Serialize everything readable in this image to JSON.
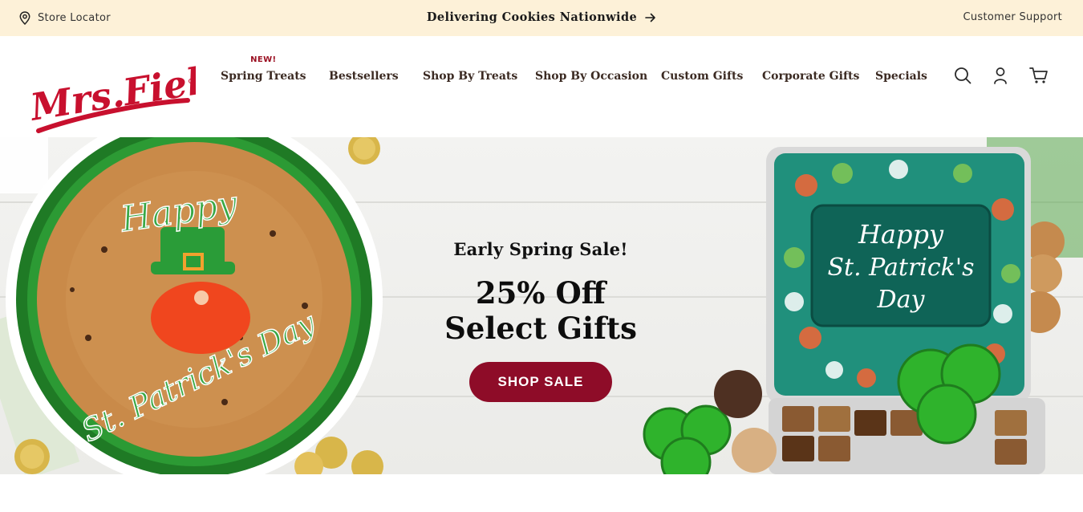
{
  "topbar": {
    "store_locator": "Store Locator",
    "promo": "Delivering Cookies Nationwide",
    "support": "Customer Support"
  },
  "brand": {
    "logo_text": "Mrs.Fields",
    "logo_color": "#c8102e"
  },
  "nav": {
    "items": [
      {
        "label": "Spring Treats",
        "badge": "NEW!"
      },
      {
        "label": "Bestsellers"
      },
      {
        "label": "Shop By Treats"
      },
      {
        "label": "Shop By Occasion"
      },
      {
        "label": "Custom Gifts"
      },
      {
        "label": "Corporate Gifts"
      },
      {
        "label": "Specials"
      }
    ],
    "icons": [
      "search-icon",
      "account-icon",
      "cart-icon"
    ]
  },
  "hero": {
    "eyebrow": "Early Spring Sale!",
    "headline_line1": "25% Off",
    "headline_line2": "Select Gifts",
    "cta": "SHOP SALE",
    "cta_color": "#8e0c28",
    "cookie_text_1": "Happy",
    "cookie_text_2": "St. Patrick's Day",
    "tin_text_1": "Happy",
    "tin_text_2": "St. Patrick's",
    "tin_text_3": "Day"
  },
  "colors": {
    "topbar_bg": "#fdf1d8",
    "accent_green": "#1f8a2a",
    "teal": "#1f8f7a"
  }
}
